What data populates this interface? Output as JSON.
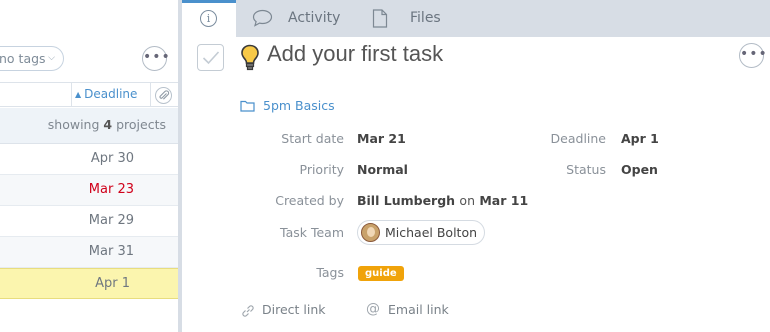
{
  "left_pane": {
    "tags_filter": "no tags",
    "more_label": "•••",
    "deadline_header": "Deadline",
    "showing_prefix": "showing",
    "showing_count": "4",
    "showing_suffix": "projects",
    "rows": [
      {
        "deadline": "Apr 30",
        "overdue": false
      },
      {
        "deadline": "Mar 23",
        "overdue": true
      },
      {
        "deadline": "Mar 29",
        "overdue": false
      },
      {
        "deadline": "Mar 31",
        "overdue": false
      },
      {
        "deadline": "Apr 1",
        "overdue": false,
        "selected": true
      }
    ]
  },
  "tabs": {
    "activity": "Activity",
    "files": "Files"
  },
  "task": {
    "title": "Add your first task",
    "project": "5pm Basics",
    "more_label": "•••"
  },
  "fields": {
    "start_date_label": "Start date",
    "start_date": "Mar 21",
    "deadline_label": "Deadline",
    "deadline": "Apr 1",
    "priority_label": "Priority",
    "priority": "Normal",
    "status_label": "Status",
    "status": "Open",
    "created_by_label": "Created by",
    "created_by_name": "Bill Lumbergh",
    "created_on_word": "on",
    "created_on_date": "Mar 11",
    "team_label": "Task Team",
    "team_member": "Michael Bolton",
    "tags_label": "Tags",
    "tag": "guide"
  },
  "footer": {
    "direct_link": "Direct link",
    "email_link": "Email link"
  },
  "colors": {
    "accent": "#4a90cc",
    "overdue": "#d0021b",
    "tag": "#f0a30a",
    "selected_row": "#fbf5ae"
  }
}
